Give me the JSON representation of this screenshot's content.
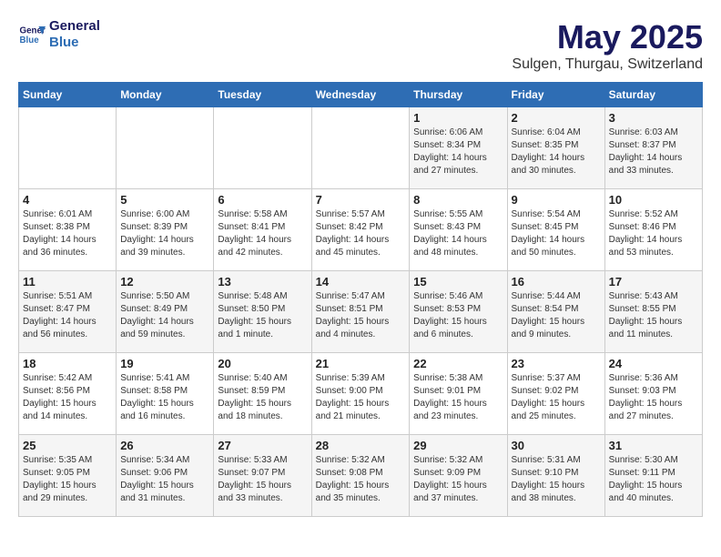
{
  "logo": {
    "line1": "General",
    "line2": "Blue"
  },
  "title": "May 2025",
  "subtitle": "Sulgen, Thurgau, Switzerland",
  "headers": [
    "Sunday",
    "Monday",
    "Tuesday",
    "Wednesday",
    "Thursday",
    "Friday",
    "Saturday"
  ],
  "weeks": [
    [
      {
        "day": "",
        "info": ""
      },
      {
        "day": "",
        "info": ""
      },
      {
        "day": "",
        "info": ""
      },
      {
        "day": "",
        "info": ""
      },
      {
        "day": "1",
        "info": "Sunrise: 6:06 AM\nSunset: 8:34 PM\nDaylight: 14 hours\nand 27 minutes."
      },
      {
        "day": "2",
        "info": "Sunrise: 6:04 AM\nSunset: 8:35 PM\nDaylight: 14 hours\nand 30 minutes."
      },
      {
        "day": "3",
        "info": "Sunrise: 6:03 AM\nSunset: 8:37 PM\nDaylight: 14 hours\nand 33 minutes."
      }
    ],
    [
      {
        "day": "4",
        "info": "Sunrise: 6:01 AM\nSunset: 8:38 PM\nDaylight: 14 hours\nand 36 minutes."
      },
      {
        "day": "5",
        "info": "Sunrise: 6:00 AM\nSunset: 8:39 PM\nDaylight: 14 hours\nand 39 minutes."
      },
      {
        "day": "6",
        "info": "Sunrise: 5:58 AM\nSunset: 8:41 PM\nDaylight: 14 hours\nand 42 minutes."
      },
      {
        "day": "7",
        "info": "Sunrise: 5:57 AM\nSunset: 8:42 PM\nDaylight: 14 hours\nand 45 minutes."
      },
      {
        "day": "8",
        "info": "Sunrise: 5:55 AM\nSunset: 8:43 PM\nDaylight: 14 hours\nand 48 minutes."
      },
      {
        "day": "9",
        "info": "Sunrise: 5:54 AM\nSunset: 8:45 PM\nDaylight: 14 hours\nand 50 minutes."
      },
      {
        "day": "10",
        "info": "Sunrise: 5:52 AM\nSunset: 8:46 PM\nDaylight: 14 hours\nand 53 minutes."
      }
    ],
    [
      {
        "day": "11",
        "info": "Sunrise: 5:51 AM\nSunset: 8:47 PM\nDaylight: 14 hours\nand 56 minutes."
      },
      {
        "day": "12",
        "info": "Sunrise: 5:50 AM\nSunset: 8:49 PM\nDaylight: 14 hours\nand 59 minutes."
      },
      {
        "day": "13",
        "info": "Sunrise: 5:48 AM\nSunset: 8:50 PM\nDaylight: 15 hours\nand 1 minute."
      },
      {
        "day": "14",
        "info": "Sunrise: 5:47 AM\nSunset: 8:51 PM\nDaylight: 15 hours\nand 4 minutes."
      },
      {
        "day": "15",
        "info": "Sunrise: 5:46 AM\nSunset: 8:53 PM\nDaylight: 15 hours\nand 6 minutes."
      },
      {
        "day": "16",
        "info": "Sunrise: 5:44 AM\nSunset: 8:54 PM\nDaylight: 15 hours\nand 9 minutes."
      },
      {
        "day": "17",
        "info": "Sunrise: 5:43 AM\nSunset: 8:55 PM\nDaylight: 15 hours\nand 11 minutes."
      }
    ],
    [
      {
        "day": "18",
        "info": "Sunrise: 5:42 AM\nSunset: 8:56 PM\nDaylight: 15 hours\nand 14 minutes."
      },
      {
        "day": "19",
        "info": "Sunrise: 5:41 AM\nSunset: 8:58 PM\nDaylight: 15 hours\nand 16 minutes."
      },
      {
        "day": "20",
        "info": "Sunrise: 5:40 AM\nSunset: 8:59 PM\nDaylight: 15 hours\nand 18 minutes."
      },
      {
        "day": "21",
        "info": "Sunrise: 5:39 AM\nSunset: 9:00 PM\nDaylight: 15 hours\nand 21 minutes."
      },
      {
        "day": "22",
        "info": "Sunrise: 5:38 AM\nSunset: 9:01 PM\nDaylight: 15 hours\nand 23 minutes."
      },
      {
        "day": "23",
        "info": "Sunrise: 5:37 AM\nSunset: 9:02 PM\nDaylight: 15 hours\nand 25 minutes."
      },
      {
        "day": "24",
        "info": "Sunrise: 5:36 AM\nSunset: 9:03 PM\nDaylight: 15 hours\nand 27 minutes."
      }
    ],
    [
      {
        "day": "25",
        "info": "Sunrise: 5:35 AM\nSunset: 9:05 PM\nDaylight: 15 hours\nand 29 minutes."
      },
      {
        "day": "26",
        "info": "Sunrise: 5:34 AM\nSunset: 9:06 PM\nDaylight: 15 hours\nand 31 minutes."
      },
      {
        "day": "27",
        "info": "Sunrise: 5:33 AM\nSunset: 9:07 PM\nDaylight: 15 hours\nand 33 minutes."
      },
      {
        "day": "28",
        "info": "Sunrise: 5:32 AM\nSunset: 9:08 PM\nDaylight: 15 hours\nand 35 minutes."
      },
      {
        "day": "29",
        "info": "Sunrise: 5:32 AM\nSunset: 9:09 PM\nDaylight: 15 hours\nand 37 minutes."
      },
      {
        "day": "30",
        "info": "Sunrise: 5:31 AM\nSunset: 9:10 PM\nDaylight: 15 hours\nand 38 minutes."
      },
      {
        "day": "31",
        "info": "Sunrise: 5:30 AM\nSunset: 9:11 PM\nDaylight: 15 hours\nand 40 minutes."
      }
    ]
  ]
}
